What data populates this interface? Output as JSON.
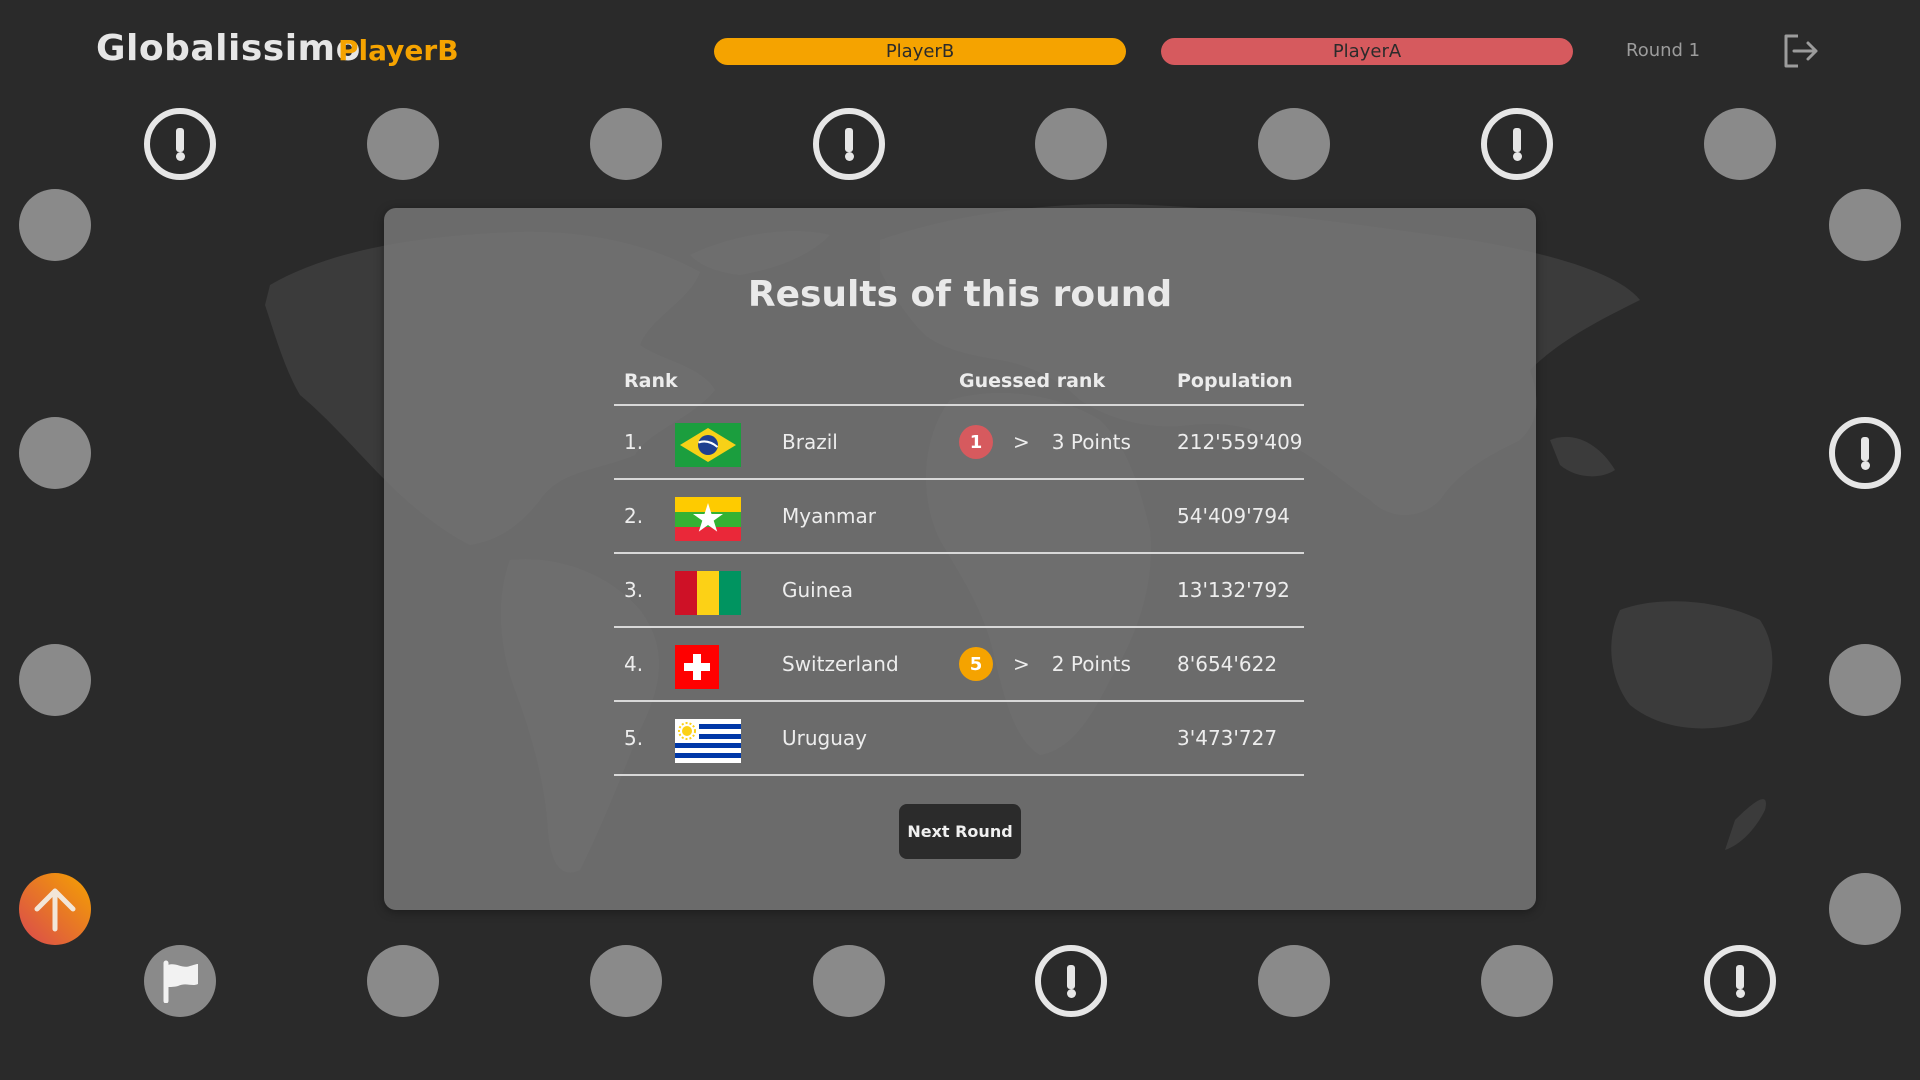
{
  "header": {
    "app_title": "Globalissimo",
    "current_player": "PlayerB",
    "round": "Round 1"
  },
  "scoreboard": [
    {
      "name": "PlayerB",
      "color": "#f5a300"
    },
    {
      "name": "PlayerA",
      "color": "#d65a5e"
    }
  ],
  "results": {
    "title": "Results of this round",
    "columns": {
      "rank": "Rank",
      "guessed": "Guessed rank",
      "population": "Population"
    },
    "rows": [
      {
        "rank": "1.",
        "country": "Brazil",
        "flag": "flag-brazil",
        "guess_badge": "1",
        "badge_color": "#d65a5e",
        "arrow": ">",
        "points": "3 Points",
        "population": "212'559'409"
      },
      {
        "rank": "2.",
        "country": "Myanmar",
        "flag": "flag-myanmar",
        "guess_badge": "",
        "badge_color": "",
        "arrow": "",
        "points": "",
        "population": "54'409'794"
      },
      {
        "rank": "3.",
        "country": "Guinea",
        "flag": "flag-guinea",
        "guess_badge": "",
        "badge_color": "",
        "arrow": "",
        "points": "",
        "population": "13'132'792"
      },
      {
        "rank": "4.",
        "country": "Switzerland",
        "flag": "flag-switzerland",
        "guess_badge": "5",
        "badge_color": "#f5a300",
        "arrow": ">",
        "points": "2 Points",
        "population": "8'654'622"
      },
      {
        "rank": "5.",
        "country": "Uruguay",
        "flag": "flag-uruguay",
        "guess_badge": "",
        "badge_color": "",
        "arrow": "",
        "points": "",
        "population": "3'473'727"
      }
    ],
    "next_button": "Next Round"
  },
  "board": {
    "icons": {
      "start": "arrow-up-icon",
      "flag": "flag-icon",
      "event": "exclamation-icon",
      "logout": "logout-icon"
    }
  }
}
